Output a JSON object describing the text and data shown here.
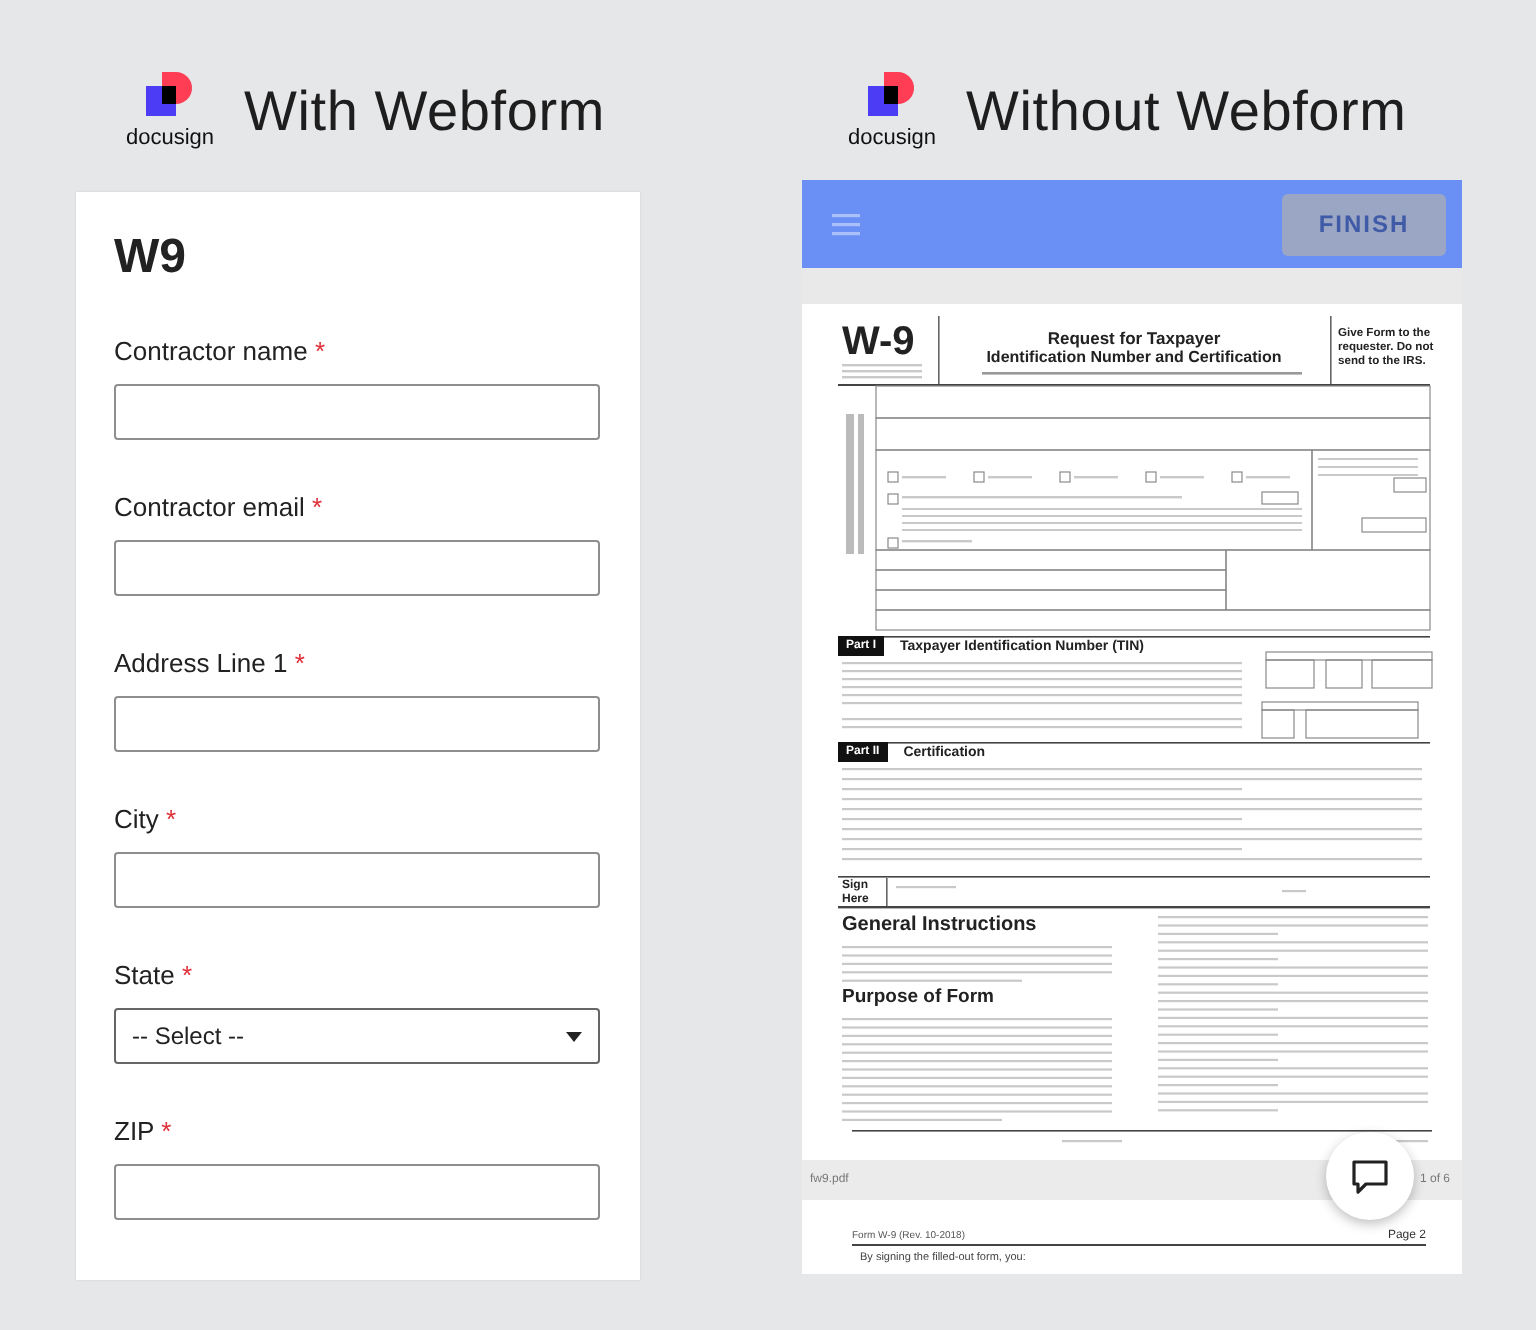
{
  "panels": [
    {
      "logo_text": "docusign",
      "title": "With Webform"
    },
    {
      "logo_text": "docusign",
      "title": "Without Webform"
    }
  ],
  "webform": {
    "heading": "W9",
    "fields": [
      {
        "label": "Contractor name",
        "required_mark": "*",
        "kind": "text"
      },
      {
        "label": "Contractor email",
        "required_mark": "*",
        "kind": "text"
      },
      {
        "label": "Address Line 1",
        "required_mark": "*",
        "kind": "text"
      },
      {
        "label": "City",
        "required_mark": "*",
        "kind": "text"
      },
      {
        "label": "State",
        "required_mark": "*",
        "kind": "select",
        "value": "-- Select --"
      },
      {
        "label": "ZIP",
        "required_mark": "*",
        "kind": "text"
      }
    ]
  },
  "viewer": {
    "finish_button": {
      "label": "FINISH",
      "disabled": true
    },
    "page_1": {
      "form_number": "W-9",
      "title_lines": [
        "Request for Taxpayer",
        "Identification Number and Certification"
      ],
      "routing_note": "Give Form to the requester. Do not send to the IRS.",
      "parts": [
        {
          "tag": "Part I",
          "title": "Taxpayer Identification Number (TIN)"
        },
        {
          "tag": "Part II",
          "title": "Certification"
        }
      ],
      "sign_label": "Sign Here",
      "headings": [
        "General Instructions",
        "Purpose of Form"
      ]
    },
    "file_name": "fw9.pdf",
    "page_count": "1 of 6",
    "page_2": {
      "form_label": "Form W-9 (Rev. 10-2018)",
      "page_label": "Page 2",
      "first_line": "By signing the filled-out form, you:"
    }
  }
}
